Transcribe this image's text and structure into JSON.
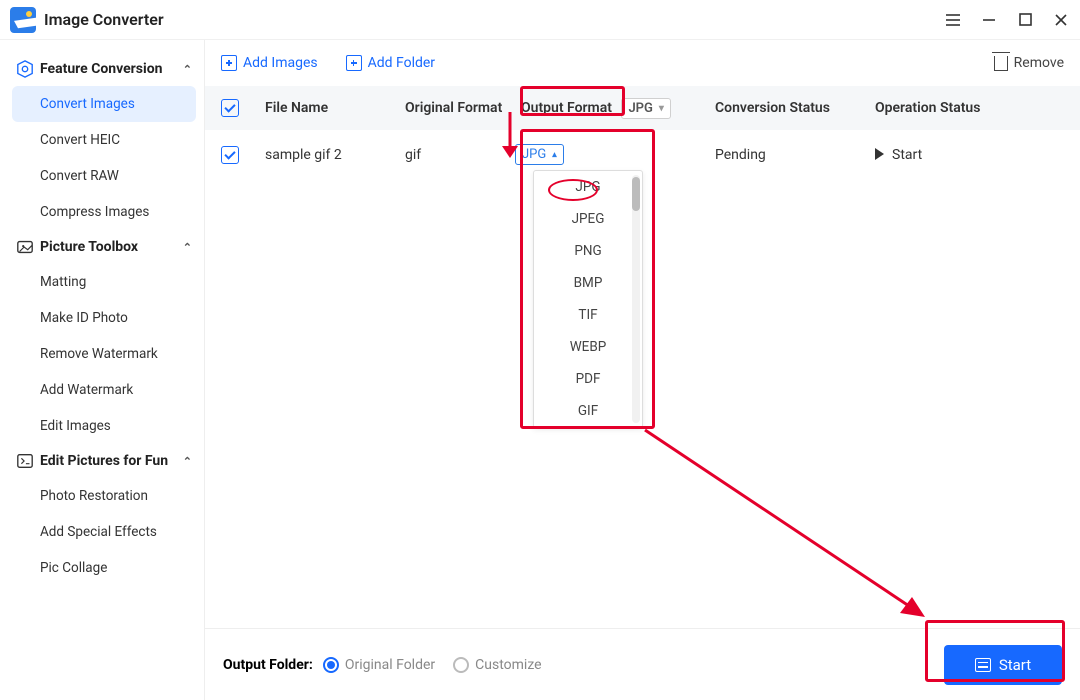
{
  "app": {
    "title": "Image Converter"
  },
  "sidebar": {
    "groups": [
      {
        "label": "Feature Conversion",
        "items": [
          "Convert Images",
          "Convert HEIC",
          "Convert RAW",
          "Compress Images"
        ]
      },
      {
        "label": "Picture Toolbox",
        "items": [
          "Matting",
          "Make ID Photo",
          "Remove Watermark",
          "Add Watermark",
          "Edit Images"
        ]
      },
      {
        "label": "Edit Pictures for Fun",
        "items": [
          "Photo Restoration",
          "Add Special Effects",
          "Pic Collage"
        ]
      }
    ],
    "active": "Convert Images"
  },
  "toolbar": {
    "add_images": "Add Images",
    "add_folder": "Add Folder",
    "remove": "Remove"
  },
  "table": {
    "headers": {
      "file_name": "File Name",
      "original_format": "Original Format",
      "output_format": "Output Format",
      "header_select": "JPG",
      "conversion_status": "Conversion Status",
      "operation_status": "Operation Status"
    },
    "rows": [
      {
        "name": "sample gif 2",
        "orig": "gif",
        "out": "JPG",
        "status": "Pending",
        "op": "Start"
      }
    ]
  },
  "dropdown": {
    "options": [
      "JPG",
      "JPEG",
      "PNG",
      "BMP",
      "TIF",
      "WEBP",
      "PDF",
      "GIF"
    ]
  },
  "footer": {
    "label": "Output Folder:",
    "opt_original": "Original Folder",
    "opt_customize": "Customize",
    "start": "Start"
  }
}
